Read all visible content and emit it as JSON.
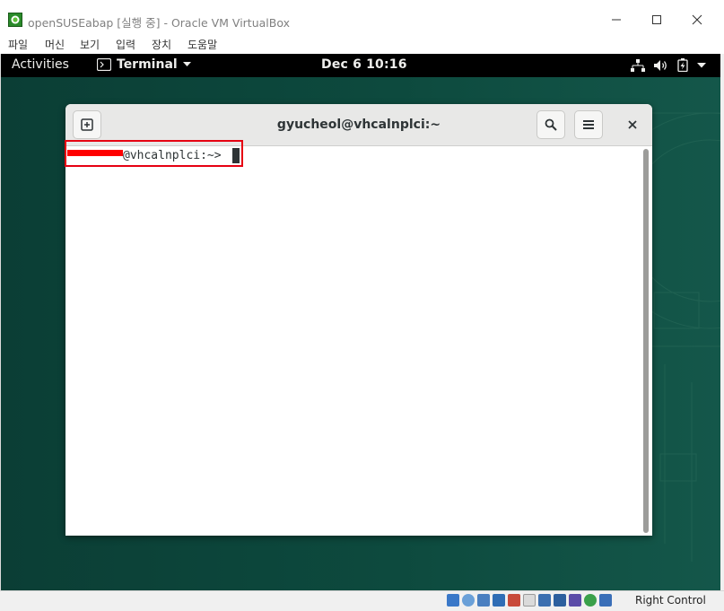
{
  "window": {
    "title": "openSUSEabap [실행 중] - Oracle VM VirtualBox"
  },
  "menubar": {
    "items": [
      {
        "label": "파일"
      },
      {
        "label": "머신"
      },
      {
        "label": "보기"
      },
      {
        "label": "입력"
      },
      {
        "label": "장치"
      },
      {
        "label": "도움말"
      }
    ]
  },
  "gnome": {
    "activities": "Activities",
    "app_menu": "Terminal",
    "clock": "Dec 6  10:16",
    "tray_icons": [
      "network-icon",
      "volume-icon",
      "battery-icon",
      "chevron-down-icon"
    ]
  },
  "terminal": {
    "title": "gyucheol@vhcalnplci:~",
    "prompt_user_hidden": "gyucheol",
    "prompt_rest": "@vhcalnplci:~> "
  },
  "statusbar": {
    "host_key": "Right Control",
    "icons": [
      "hdd-icon",
      "cd-icon",
      "audio-icon",
      "network-icon",
      "usb-icon",
      "shared-folder-icon",
      "display-icon",
      "recording-icon",
      "cpu-vt-icon",
      "mouse-integration-icon",
      "keyboard-capture-icon"
    ]
  },
  "colors": {
    "highlight_box": "#e60012",
    "redaction": "#ff0000",
    "desktop": "#0b3e35"
  }
}
